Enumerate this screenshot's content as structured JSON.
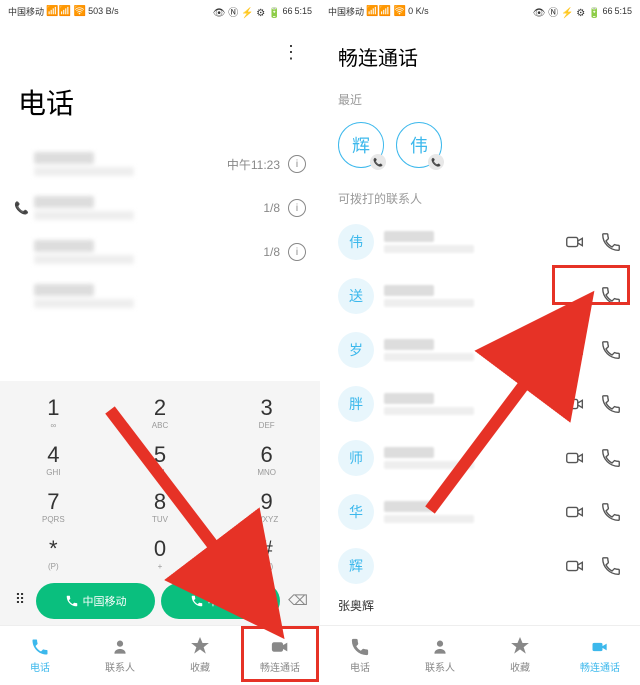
{
  "statusbar": {
    "carrier1": "中国移动",
    "carrier2": "中国移动",
    "hd": "HD",
    "net": "4G",
    "sig": "📶",
    "speed1": "503\nB/s",
    "speed2": "0\nK/s",
    "icons": "👁 Ⓝ ⚡ ⚙",
    "battery": "66",
    "time": "5:15"
  },
  "left": {
    "title": "电话",
    "menu": "⋮",
    "calls": [
      {
        "time": "中午11:23"
      },
      {
        "icon": "↗",
        "time": "1/8"
      },
      {
        "time": "1/8"
      },
      {
        "time": ""
      }
    ],
    "dialpad": [
      [
        "1",
        "∞"
      ],
      [
        "2",
        "ABC"
      ],
      [
        "3",
        "DEF"
      ],
      [
        "4",
        "GHI"
      ],
      [
        "5",
        "JKL"
      ],
      [
        "6",
        "MNO"
      ],
      [
        "7",
        "PQRS"
      ],
      [
        "8",
        "TUV"
      ],
      [
        "9",
        "WXYZ"
      ],
      [
        "*",
        "(P)"
      ],
      [
        "0",
        "+"
      ],
      [
        "#",
        "(W)"
      ]
    ],
    "call_btn": "中国移动",
    "nav": [
      {
        "label": "电话",
        "active": true
      },
      {
        "label": "联系人"
      },
      {
        "label": "收藏"
      },
      {
        "label": "畅连通话"
      }
    ]
  },
  "right": {
    "title": "畅连通话",
    "recent_label": "最近",
    "recent": [
      "辉",
      "伟"
    ],
    "contacts_label": "可拨打的联系人",
    "contacts": [
      "伟",
      "送",
      "岁",
      "胖",
      "师",
      "华",
      "辉"
    ],
    "bottom_name": "张奥辉",
    "nav": [
      {
        "label": "电话"
      },
      {
        "label": "联系人"
      },
      {
        "label": "收藏"
      },
      {
        "label": "畅连通话",
        "active": true
      }
    ]
  }
}
